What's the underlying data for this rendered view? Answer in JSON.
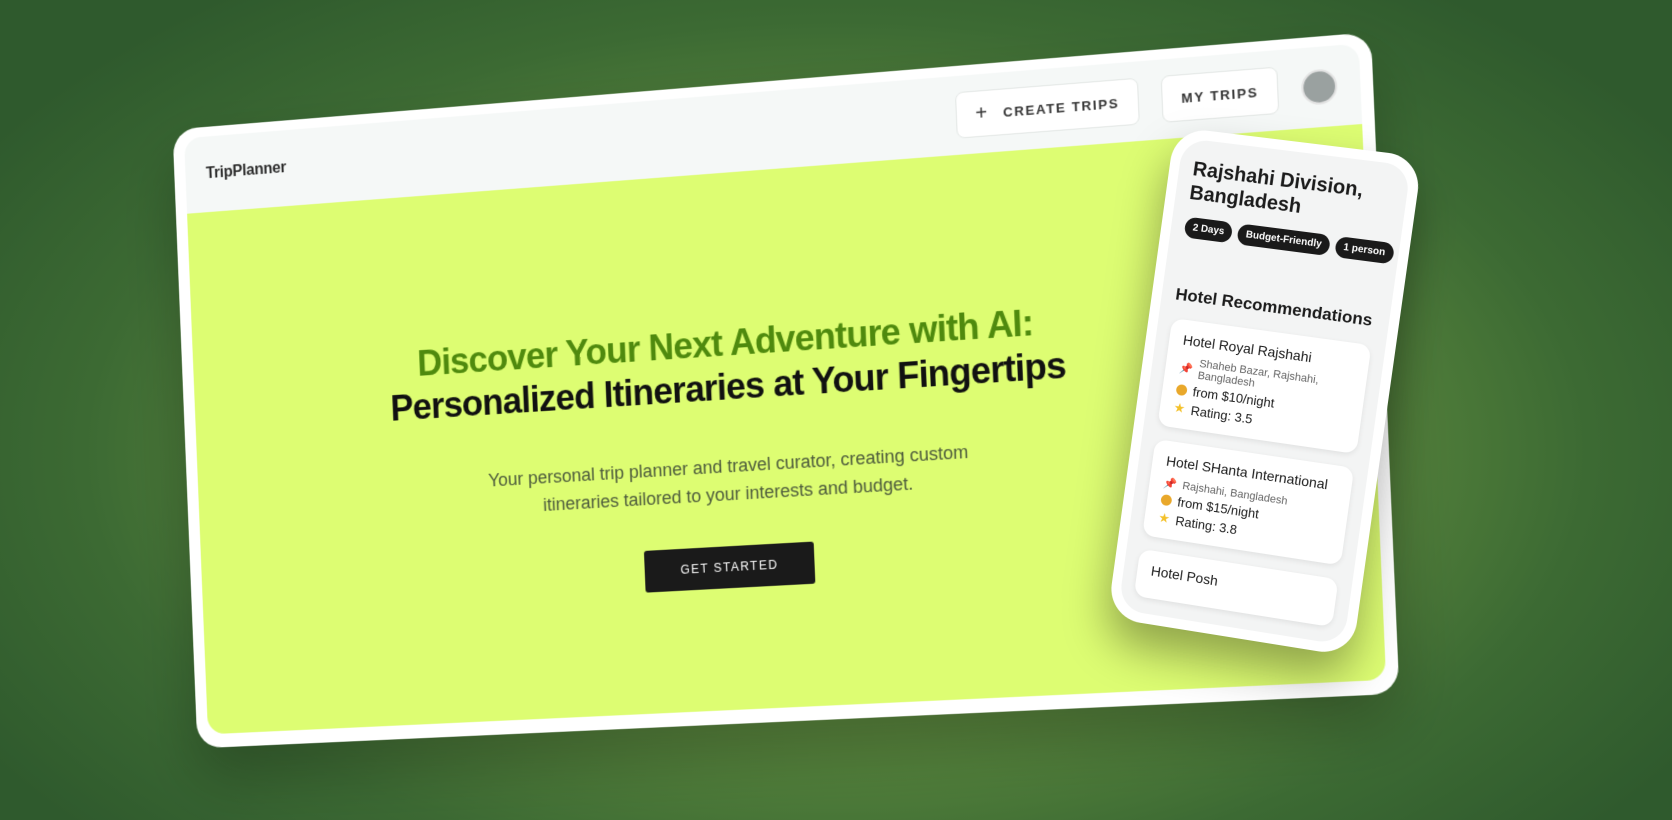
{
  "app": {
    "logo": "TripPlanner"
  },
  "nav": {
    "create_trips": "CREATE TRIPS",
    "my_trips": "MY TRIPS"
  },
  "hero": {
    "headline_green": "Discover Your Next Adventure with AI:",
    "headline_black": "Personalized Itineraries at Your Fingertips",
    "subtitle": "Your personal trip planner and travel curator, creating custom itineraries tailored to your interests and budget.",
    "cta": "GET STARTED"
  },
  "phone": {
    "location": "Rajshahi Division, Bangladesh",
    "tags": [
      "2 Days",
      "Budget-Friendly",
      "1 person"
    ],
    "section_title": "Hotel Recommendations",
    "hotels": [
      {
        "name": "Hotel Royal Rajshahi",
        "address": "Shaheb Bazar, Rajshahi, Bangladesh",
        "price": "from $10/night",
        "rating": "Rating: 3.5"
      },
      {
        "name": "Hotel SHanta International",
        "address": "Rajshahi, Bangladesh",
        "price": "from $15/night",
        "rating": "Rating: 3.8"
      },
      {
        "name": "Hotel Posh"
      }
    ]
  },
  "colors": {
    "hero_bg": "#ddfd72",
    "headline_green": "#4f8a0e",
    "cta_bg": "#1a1a1a"
  },
  "icons": [
    "plus-icon",
    "pin-icon",
    "coin-icon",
    "star-icon"
  ]
}
